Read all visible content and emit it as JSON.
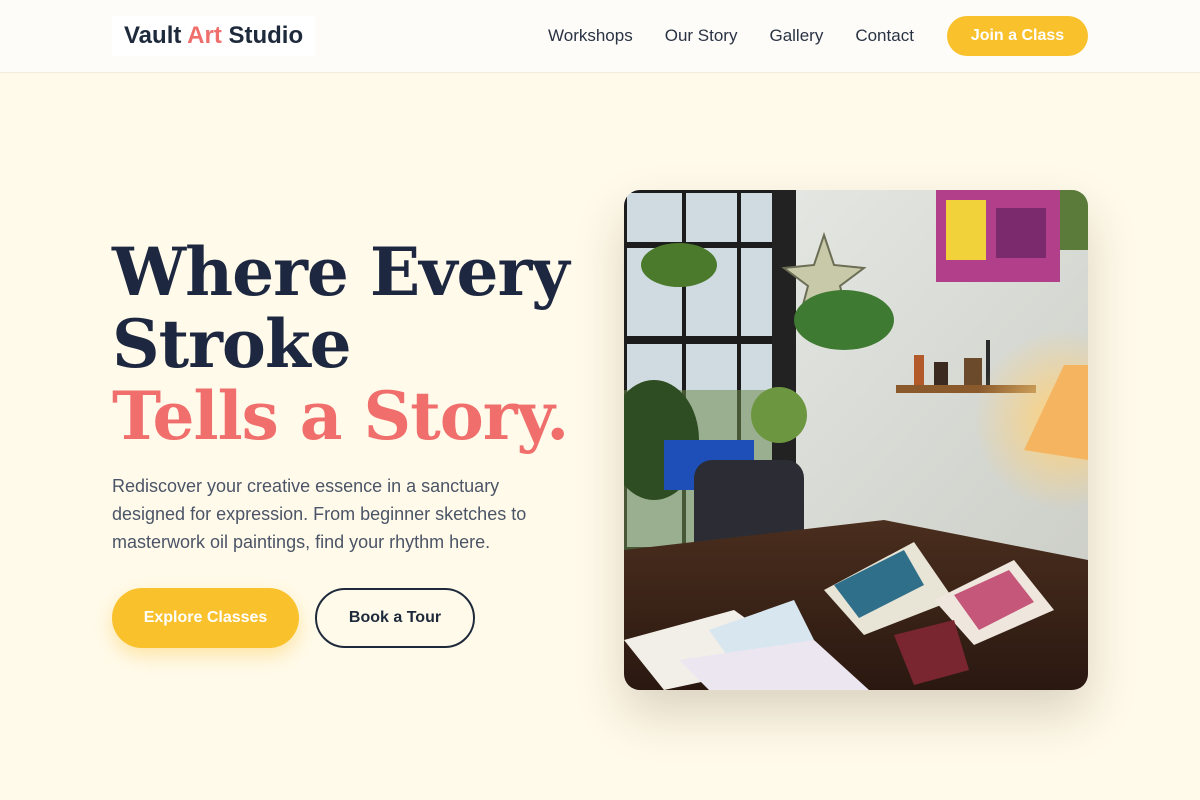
{
  "header": {
    "logo": {
      "part1": "Vault ",
      "accent": "Art",
      "part2": " Studio"
    },
    "nav": [
      "Workshops",
      "Our Story",
      "Gallery",
      "Contact"
    ],
    "cta_label": "Join a Class"
  },
  "hero": {
    "headline": {
      "line1": "Where Every",
      "line2": "Stroke",
      "line3": "Tells a Story."
    },
    "lead": "Rediscover your creative essence in a sanctuary designed for expression. From beginner sketches to masterwork oil paintings, find your rhythm here.",
    "primary_button": "Explore Classes",
    "secondary_button": "Book a Tour",
    "image_alt": "art-studio-photo"
  },
  "colors": {
    "background": "#fffaea",
    "accent_yellow": "#f9c12c",
    "accent_coral": "#ef6f6c",
    "navy": "#1e2a3b"
  }
}
